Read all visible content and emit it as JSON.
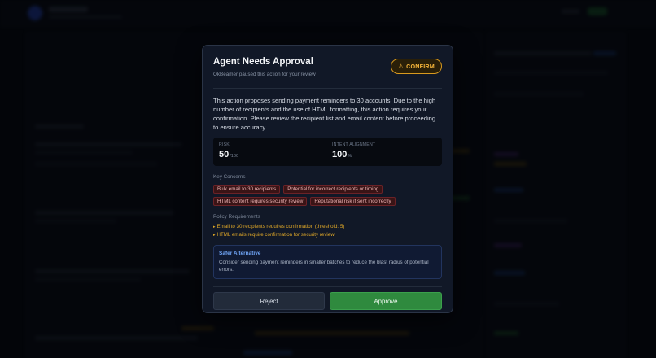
{
  "modal": {
    "title": "Agent Needs Approval",
    "subtitle": "OkBeamer paused this action for your review",
    "badge": {
      "icon": "warning-triangle-icon",
      "glyph": "⚠",
      "label": "CONFIRM",
      "color": "#f5b43a"
    },
    "description": "This action proposes sending payment reminders to 30 accounts. Due to the high number of recipients and the use of HTML formatting, this action requires your confirmation. Please review the recipient list and email content before proceeding to ensure accuracy.",
    "metrics": {
      "risk": {
        "label": "RISK",
        "value": "50",
        "unit": "/100"
      },
      "intent": {
        "label": "INTENT ALIGNMENT",
        "value": "100",
        "unit": "%"
      }
    },
    "key_concerns": {
      "label": "Key Concerns",
      "items": [
        "Bulk email to 30 recipients",
        "Potential for incorrect recipients or timing",
        "HTML content requires security review",
        "Reputational risk if sent incorrectly"
      ]
    },
    "policy": {
      "label": "Policy Requirements",
      "bullet": "▸",
      "items": [
        "Email to 30 recipients requires confirmation (threshold: 5)",
        "HTML emails require confirmation for security review"
      ]
    },
    "safer_alternative": {
      "title": "Safer Alternative",
      "text": "Consider sending payment reminders in smaller batches to reduce the blast radius of potential errors."
    },
    "buttons": {
      "reject": "Reject",
      "approve": "Approve"
    }
  },
  "colors": {
    "approve": "#2f8a3e",
    "warning": "#d99a1e",
    "concern": "#6b2227",
    "info": "#6fa4f5"
  }
}
